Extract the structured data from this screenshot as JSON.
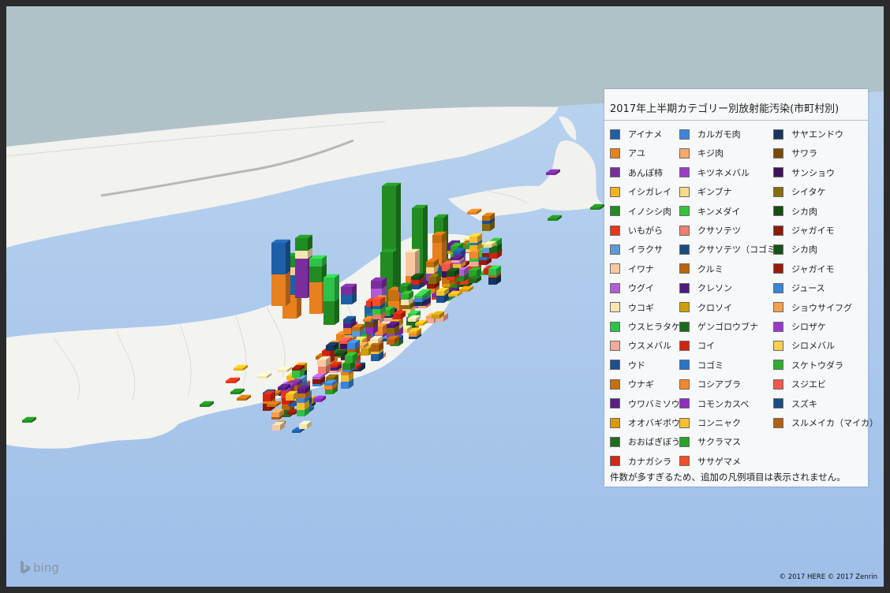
{
  "legend": {
    "title": "2017年上半期カテゴリー別放射能汚染(市町村別)",
    "note": "件数が多すぎるため、追加の凡例項目は表示されません。",
    "columns": [
      [
        {
          "label": "アイナメ",
          "color": "#1f5fa8"
        },
        {
          "label": "アユ",
          "color": "#e8801e"
        },
        {
          "label": "あんぽ柿",
          "color": "#7a2e9e"
        },
        {
          "label": "イシガレイ",
          "color": "#f2b41c"
        },
        {
          "label": "イノシシ肉",
          "color": "#228b22"
        },
        {
          "label": "いもがら",
          "color": "#e8361c"
        },
        {
          "label": "イラクサ",
          "color": "#5b9bd5"
        },
        {
          "label": "イワナ",
          "color": "#f8c9a0"
        },
        {
          "label": "ウグイ",
          "color": "#b15cd6"
        },
        {
          "label": "ウコギ",
          "color": "#f8e5b0"
        },
        {
          "label": "ウスヒラタケ",
          "color": "#2ec24a"
        },
        {
          "label": "ウスメバル",
          "color": "#f2a99a"
        },
        {
          "label": "ウド",
          "color": "#1d4f8c"
        },
        {
          "label": "ウナギ",
          "color": "#c7700e"
        },
        {
          "label": "ウワバミソウ",
          "color": "#5a1f86"
        },
        {
          "label": "オオバギボウシ",
          "color": "#d99a00"
        },
        {
          "label": "おおばぎぼうし",
          "color": "#1e6e1e"
        },
        {
          "label": "カナガシラ",
          "color": "#d12812"
        }
      ],
      [
        {
          "label": "カルガモ肉",
          "color": "#3d86d9"
        },
        {
          "label": "キジ肉",
          "color": "#f5a96a"
        },
        {
          "label": "キツネメバル",
          "color": "#9b3fc9"
        },
        {
          "label": "ギンブナ",
          "color": "#f8d98a"
        },
        {
          "label": "キンメダイ",
          "color": "#34c43c"
        },
        {
          "label": "クサソテツ",
          "color": "#ee7e6f"
        },
        {
          "label": "クサソテツ（コゴミ）",
          "color": "#1a4a80"
        },
        {
          "label": "クルミ",
          "color": "#b8650c"
        },
        {
          "label": "クレソン",
          "color": "#4f1a7d"
        },
        {
          "label": "クロソイ",
          "color": "#cf9e06"
        },
        {
          "label": "ゲンゴロウブナ",
          "color": "#1c6b1c"
        },
        {
          "label": "コイ",
          "color": "#d0240e"
        },
        {
          "label": "コゴミ",
          "color": "#2c74c4"
        },
        {
          "label": "コシアブラ",
          "color": "#f08a2e"
        },
        {
          "label": "コモンカスベ",
          "color": "#8f2fc0"
        },
        {
          "label": "コンニャク",
          "color": "#f5c030"
        },
        {
          "label": "サクラマス",
          "color": "#29a329"
        },
        {
          "label": "ササゲマメ",
          "color": "#f24e2a"
        }
      ],
      [
        {
          "label": "サヤエンドウ",
          "color": "#16365e"
        },
        {
          "label": "サワラ",
          "color": "#7a4a0a"
        },
        {
          "label": "サンショウ",
          "color": "#3d1459"
        },
        {
          "label": "シイタケ",
          "color": "#8a6a06"
        },
        {
          "label": "シカ肉",
          "color": "#154d15"
        },
        {
          "label": "ジャガイモ",
          "color": "#8c1a0b"
        },
        {
          "label": "シカ肉",
          "color": "#155218"
        },
        {
          "label": "ジャガイモ",
          "color": "#951c0c"
        },
        {
          "label": "ジュース",
          "color": "#3a84d6"
        },
        {
          "label": "ショウサイフグ",
          "color": "#f2a052"
        },
        {
          "label": "シロザケ",
          "color": "#9a38cc"
        },
        {
          "label": "シロメバル",
          "color": "#f8cf50"
        },
        {
          "label": "スケトウダラ",
          "color": "#2fae2f"
        },
        {
          "label": "スジエビ",
          "color": "#f0584a"
        },
        {
          "label": "スズキ",
          "color": "#1c4a82"
        },
        {
          "label": "スルメイカ（マイカ）",
          "color": "#b06010"
        }
      ]
    ]
  },
  "branding": {
    "logo_text": "bing"
  },
  "copyright": "© 2017 HERE  © 2017 Zenrin"
}
